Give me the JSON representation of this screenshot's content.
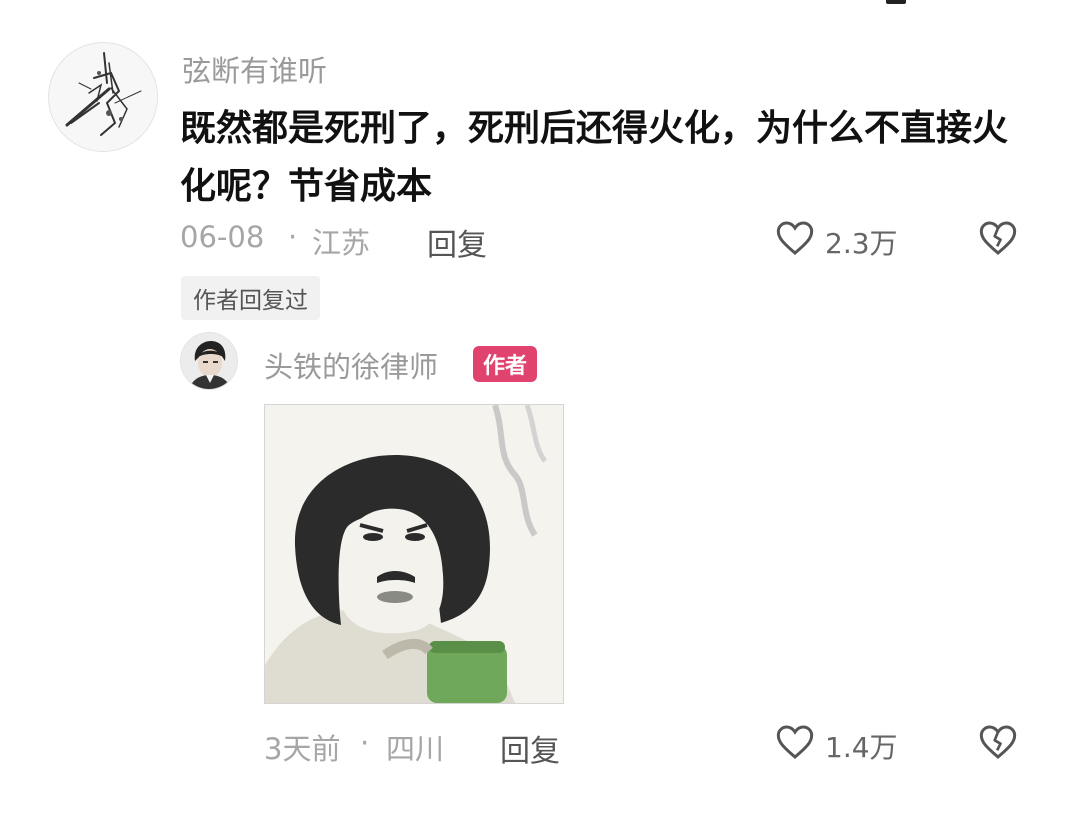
{
  "comment": {
    "username": "弦断有谁听",
    "text": "既然都是死刑了，死刑后还得火化，为什么不直接火化呢？节省成本",
    "date": "06-08",
    "separator": "·",
    "location": "江苏",
    "reply_label": "回复",
    "likes": "2.3万",
    "author_replied_tag": "作者回复过"
  },
  "reply": {
    "username": "头铁的徐律师",
    "author_badge": "作者",
    "date": "3天前",
    "separator": "·",
    "location": "四川",
    "reply_label": "回复",
    "likes": "1.4万"
  },
  "icons": {
    "like": "heart-outline-icon",
    "dislike": "broken-heart-icon"
  },
  "colors": {
    "badge": "#e0436d"
  }
}
